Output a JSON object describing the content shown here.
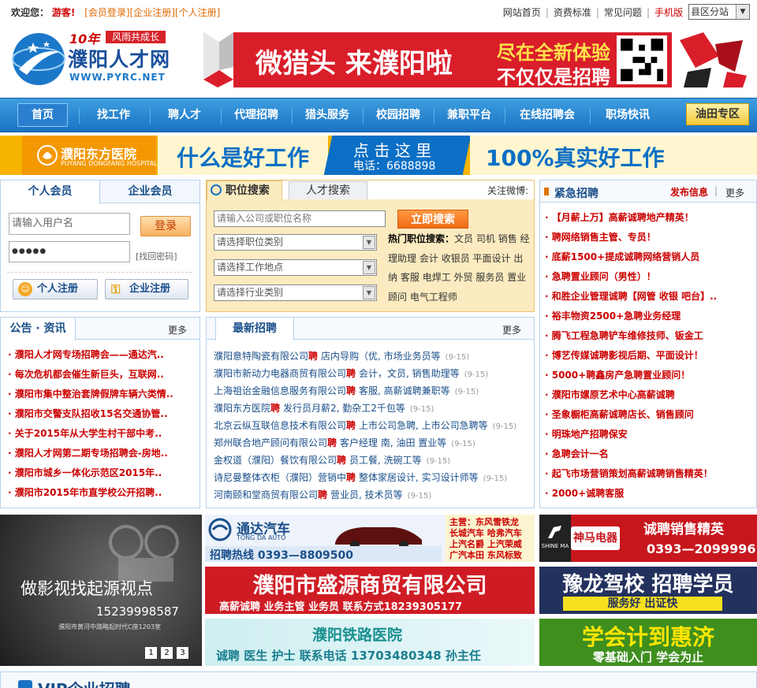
{
  "topbar": {
    "welcome_label": "欢迎您：",
    "guest": "游客!",
    "links_left": [
      "[会员登录]",
      "[企业注册]",
      "[个人注册]"
    ],
    "links_right": [
      "网站首页",
      "资费标准",
      "常见问题",
      "手机版"
    ],
    "city_select": "县区分站"
  },
  "logo": {
    "brand": "濮阳人才网",
    "slogan": "风雨共成长",
    "years": "10年",
    "url": "WWW.PYRC.NET"
  },
  "banner_top": {
    "headline": "微猎头 来濮阳啦",
    "line1": "尽在全新体验",
    "line2": "不仅仅是招聘"
  },
  "nav": {
    "items": [
      "首页",
      "找工作",
      "聘人才",
      "代理招聘",
      "猎头服务",
      "校园招聘",
      "兼职平台",
      "在线招聘会",
      "职场快讯"
    ],
    "special": "油田专区"
  },
  "banner_mid": {
    "hospital": "濮阳东方医院",
    "hospital_en": "PUYANG DONGFANG HOSPITAL",
    "left_text": "什么是好工作",
    "click_here": "点 击 这 里",
    "phone": "电话：6688898",
    "right_text": "100%真实好工作"
  },
  "login": {
    "tab_personal": "个人会员",
    "tab_company": "企业会员",
    "username_placeholder": "请输入用户名",
    "password_value": "●●●●●",
    "login_button": "登录",
    "forgot": "[找回密码]",
    "personal_register": "个人注册",
    "company_register": "企业注册"
  },
  "search": {
    "tab_jobs": "职位搜索",
    "tab_talent": "人才搜索",
    "follow_weibo": "关注微博:",
    "keyword_placeholder": "请输入公司或职位名称",
    "search_button": "立即搜索",
    "select_category": "请选择职位类别",
    "select_location": "请选择工作地点",
    "select_industry": "请选择行业类别",
    "hot_label": "热门职位搜索：",
    "hot_jobs": [
      "文员",
      "司机",
      "销售",
      "经理助理",
      "会计",
      "收银员",
      "平面设计",
      "出纳",
      "客服",
      "电焊工",
      "外贸",
      "服务员",
      "置业顾问",
      "电气工程师"
    ]
  },
  "urgent": {
    "title": "紧急招聘",
    "publish": "发布信息",
    "more": "更多",
    "items": [
      "【月薪上万】高薪诚聘地产精英！",
      "聘网络销售主管、专员！",
      "底薪1500+提成诚聘网络营销人员",
      "急聘置业顾问（男性）！",
      "和胜企业管理诚聘【网管 收银 吧台】..",
      "裕丰物资2500+急聘业务经理",
      "腾飞工程急聘铲车维修技师、钣金工",
      "博艺传媒诚聘影视后期、平面设计！",
      "5000+聘鑫房产急聘置业顾问！",
      "濮阳市嫘原艺术中心高薪诚聘",
      "圣象橱柜高薪诚聘店长、销售顾问",
      "明珠地产招聘保安",
      "急聘会计一名",
      "起飞市场营销策划高薪诚聘销售精英！",
      "2000+诚聘客服"
    ]
  },
  "news": {
    "title": "公告 · 资讯",
    "more": "更多",
    "items": [
      "濮阳人才网专场招聘会——通达汽..",
      "每次危机都会催生新巨头，互联网..",
      "濮阳市集中整治套牌假牌车辆六类情..",
      "濮阳市交警支队招收15名交通协管..",
      "关于2015年从大学生村干部中考..",
      "濮阳人才网第二期专场招聘会-房地..",
      "濮阳市城乡一体化示范区2015年..",
      "濮阳市2015年市直学校公开招聘.."
    ]
  },
  "latest": {
    "title": "最新招聘",
    "more": "更多",
    "rows": [
      {
        "company": "濮阳意特陶瓷有限公司",
        "jobs": "店内导购（优, 市场业务员等",
        "date": "(9-15)"
      },
      {
        "company": "濮阳市新动力电器商贸有限公司",
        "jobs": "会计，文员, 销售助理等",
        "date": "(9-15)"
      },
      {
        "company": "上海祖诒金融信息服务有限公司",
        "jobs": "客服, 高薪诚聘兼职等",
        "date": "(9-15)"
      },
      {
        "company": "濮阳东方医院",
        "jobs": "发行员月薪2, 勤杂工2千包等",
        "date": "(9-15)"
      },
      {
        "company": "北京云纵互联信息技术有限公司",
        "jobs": "上市公司急聘, 上市公司急聘等",
        "date": "(9-15)"
      },
      {
        "company": "郑州联合地产顾问有限公司",
        "jobs": "客户经理 南, 油田 置业等",
        "date": "(9-15)"
      },
      {
        "company": "金权道（濮阳）餐饮有限公司",
        "jobs": "员工餐, 洗碗工等",
        "date": "(9-15)"
      },
      {
        "company": "诗尼曼整体衣柜（濮阳）营销中",
        "jobs": "整体家居设计, 实习设计师等",
        "date": "(9-15)"
      },
      {
        "company": "河南颐和堂商贸有限公司",
        "jobs": "营业员, 技术员等",
        "date": "(9-15)"
      }
    ],
    "pin_char": "聘"
  },
  "ads": {
    "video_title": "做影视找起源视点",
    "video_phone": "15239998587",
    "video_addr": "濮阳市黄河中路略起时代C座1203室",
    "slides": [
      "1",
      "2",
      "3"
    ],
    "tongda_name": "通达汽车",
    "tongda_en": "TONG DA AUTO",
    "tongda_hotline": "招聘热线 0393—8809500",
    "tongda_brands": [
      "主营：东风雪铁龙",
      "长城汽车 哈弗汽车",
      "上汽名爵 上汽荣威",
      "广汽本田 东风标致"
    ],
    "shenma_name": "神马电器",
    "shenma_en": "SHINE MA",
    "shenma_title": "诚聘销售精英",
    "shenma_phone": "0393—2099996",
    "shengyuan_name": "濮阳市盛源商贸有限公司",
    "shengyuan_info": "高薪诚聘 业务主管 业务员   联系方式18239305177",
    "yulong_title": "豫龙驾校 招聘学员",
    "yulong_sub": "服务好 出证快",
    "railway_name": "濮阳铁路医院",
    "railway_info": "诚聘 医生 护士 联系电话 13703480348 孙主任",
    "accounting_title": "学会计到惠济",
    "accounting_sub": "零基础入门 学会为止"
  },
  "vip": {
    "title": "VIP企业招聘"
  }
}
